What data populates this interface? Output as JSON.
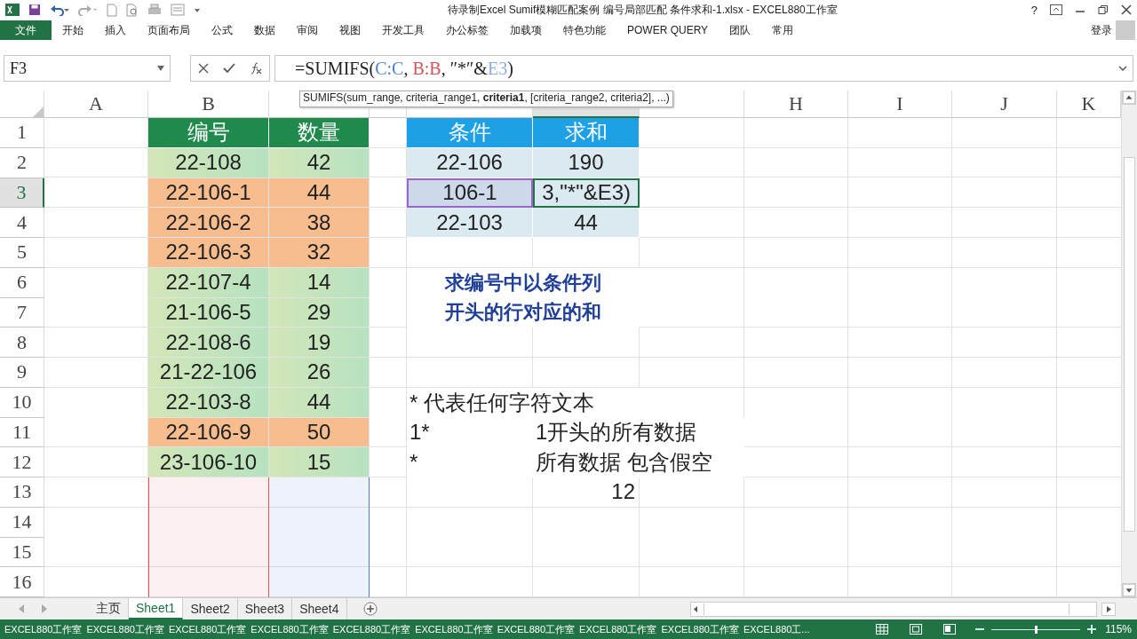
{
  "title_bar": {
    "title": "待录制Excel Sumif模糊匹配案例 编号局部匹配 条件求和-1.xlsx - EXCEL880工作室",
    "help": "?"
  },
  "ribbon": {
    "file_tab": "文件",
    "tabs": [
      "开始",
      "插入",
      "页面布局",
      "公式",
      "数据",
      "审阅",
      "视图",
      "开发工具",
      "办公标签",
      "加载项",
      "特色功能",
      "POWER QUERY",
      "团队",
      "常用"
    ],
    "sign_in": "登录"
  },
  "formula_bar": {
    "name_box": "F3",
    "formula": [
      {
        "text": "=SUMIFS("
      },
      {
        "text": "C:C",
        "color": "#4a7fd0"
      },
      {
        "text": ", "
      },
      {
        "text": "B:B",
        "color": "#d0555a"
      },
      {
        "text": ", ″*″&"
      },
      {
        "text": "E3",
        "color": "#8aaee0"
      },
      {
        "text": ")"
      }
    ]
  },
  "tooltip": "SUMIFS(sum_range, criteria_range1, **criteria1**, [criteria_range2, criteria2], ...)",
  "sheet": {
    "columns": [
      {
        "label": "A",
        "selected": false
      },
      {
        "label": "B",
        "selected": false,
        "color": "#e0565b"
      },
      {
        "selected": false,
        "color": "#4a7fd0"
      },
      {
        "selected": false
      },
      {
        "selected": false
      },
      {
        "selected": true
      },
      {
        "selected": false
      },
      {
        "label": "H",
        "selected": false
      },
      {
        "label": "I",
        "selected": false
      },
      {
        "label": "J",
        "selected": false
      },
      {
        "label": "K",
        "selected": false
      }
    ],
    "rows": [
      {
        "label": "1",
        "selected": false,
        "cells": [
          "",
          {
            "kind": "header",
            "text": "编号",
            "color": "#1f8a4c"
          },
          {
            "kind": "header",
            "text": "数量",
            "color": "#1f8a4c"
          },
          "",
          {
            "kind": "header",
            "text": "条件",
            "color": "#1ea0e6"
          },
          {
            "kind": "header",
            "text": "求和",
            "color": "#1ea0e6"
          }
        ]
      },
      {
        "label": "2",
        "selected": false,
        "cells": [
          "",
          {
            "kind": "data",
            "text": "22-108",
            "highlighted": false
          },
          {
            "kind": "data",
            "text": "42",
            "highlighted": false
          },
          "",
          {
            "kind": "table",
            "text": "22-106",
            "selected": false,
            "editing": false
          },
          {
            "kind": "table",
            "text": "190",
            "selected": false,
            "editing": false
          }
        ]
      },
      {
        "label": "3",
        "selected": true,
        "cells": [
          "",
          {
            "kind": "data",
            "text": "22-106-1",
            "highlighted": true
          },
          {
            "kind": "data",
            "text": "44",
            "highlighted": true
          },
          "",
          {
            "kind": "table",
            "text": "106-1",
            "selected": true,
            "editing": false
          },
          {
            "kind": "table",
            "text": "3,\"*\"&E3)",
            "selected": false,
            "editing": true
          }
        ]
      },
      {
        "label": "4",
        "selected": false,
        "cells": [
          "",
          {
            "kind": "data",
            "text": "22-106-2",
            "highlighted": true
          },
          {
            "kind": "data",
            "text": "38",
            "highlighted": true
          },
          "",
          {
            "kind": "table",
            "text": "22-103",
            "selected": false,
            "editing": false
          },
          {
            "kind": "table",
            "text": "44",
            "selected": false,
            "editing": false
          }
        ]
      },
      {
        "label": "5",
        "selected": false,
        "cells": [
          "",
          {
            "kind": "data",
            "text": "22-106-3",
            "highlighted": true
          },
          {
            "kind": "data",
            "text": "32",
            "highlighted": true
          }
        ]
      },
      {
        "label": "6",
        "selected": false,
        "cells": [
          "",
          {
            "kind": "data",
            "text": "22-107-4",
            "highlighted": false
          },
          {
            "kind": "data",
            "text": "14",
            "highlighted": false
          },
          "",
          {
            "kind": "note",
            "text": "求编号中以条件列"
          }
        ]
      },
      {
        "label": "7",
        "selected": false,
        "cells": [
          "",
          {
            "kind": "data",
            "text": "21-106-5",
            "highlighted": false
          },
          {
            "kind": "data",
            "text": "29",
            "highlighted": false
          },
          "",
          {
            "kind": "note",
            "text": "开头的行对应的和"
          }
        ]
      },
      {
        "label": "8",
        "selected": false,
        "cells": [
          "",
          {
            "kind": "data",
            "text": "22-108-6",
            "highlighted": false
          },
          {
            "kind": "data",
            "text": "19",
            "highlighted": false
          }
        ]
      },
      {
        "label": "9",
        "selected": false,
        "cells": [
          "",
          {
            "kind": "data",
            "text": "21-22-106",
            "highlighted": false
          },
          {
            "kind": "data",
            "text": "26",
            "highlighted": false
          }
        ]
      },
      {
        "label": "10",
        "selected": false,
        "cells": [
          "",
          {
            "kind": "data",
            "text": "22-103-8",
            "highlighted": false
          },
          {
            "kind": "data",
            "text": "44",
            "highlighted": false
          },
          "",
          {
            "kind": "text",
            "text": "* 代表任何字符文本"
          }
        ]
      },
      {
        "label": "11",
        "selected": false,
        "cells": [
          "",
          {
            "kind": "data",
            "text": "22-106-9",
            "highlighted": true
          },
          {
            "kind": "data",
            "text": "50",
            "highlighted": true
          },
          "",
          {
            "kind": "text",
            "text": "1*"
          },
          {
            "kind": "text",
            "text": "1开头的所有数据"
          }
        ]
      },
      {
        "label": "12",
        "selected": false,
        "cells": [
          "",
          {
            "kind": "data",
            "text": "23-106-10",
            "highlighted": false
          },
          {
            "kind": "data",
            "text": "15",
            "highlighted": false
          },
          "",
          {
            "kind": "text",
            "text": "*"
          },
          {
            "kind": "text",
            "text": "所有数据 包含假空"
          }
        ]
      },
      {
        "label": "13",
        "selected": false,
        "cells": [
          "",
          "",
          "",
          "",
          "",
          {
            "kind": "number",
            "text": "12"
          }
        ]
      },
      {
        "label": "14",
        "selected": false
      },
      {
        "label": "15",
        "selected": false
      },
      {
        "label": "16",
        "selected": false
      }
    ]
  },
  "sheet_tabs": [
    {
      "label": "主页",
      "selected": false
    },
    {
      "label": "Sheet1",
      "selected": true
    },
    {
      "label": "Sheet2",
      "selected": false
    },
    {
      "label": "Sheet3",
      "selected": false
    },
    {
      "label": "Sheet4",
      "selected": false
    }
  ],
  "status_bar": {
    "messages": [
      "EXCEL880工作室",
      "EXCEL880工作室",
      "EXCEL880工作室",
      "EXCEL880工作室",
      "EXCEL880工作室",
      "EXCEL880工作室",
      "EXCEL880工作室",
      "EXCEL880工作室",
      "EXCEL880工作室",
      "EXCEL880工..."
    ],
    "zoom": {
      "level": 0.5,
      "reading": "115%"
    }
  }
}
